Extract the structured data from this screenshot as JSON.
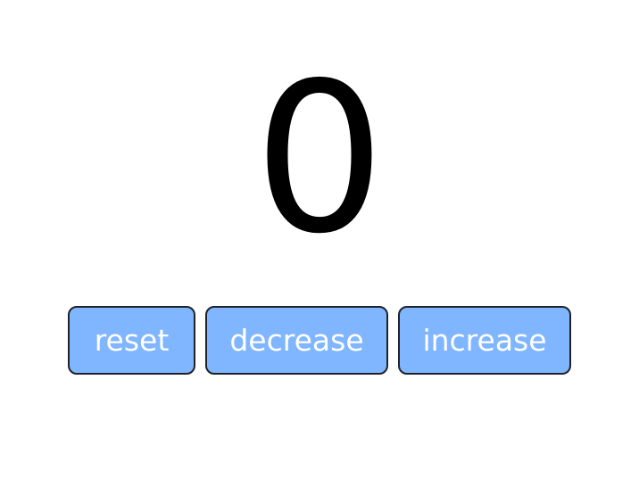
{
  "counter": {
    "value": "0"
  },
  "buttons": {
    "reset_label": "reset",
    "decrease_label": "decrease",
    "increase_label": "increase"
  },
  "colors": {
    "button_fill": "#7fb6ff",
    "button_border": "#1f2329",
    "button_text": "#ffffff",
    "counter_text": "#000000",
    "background": "#ffffff"
  }
}
